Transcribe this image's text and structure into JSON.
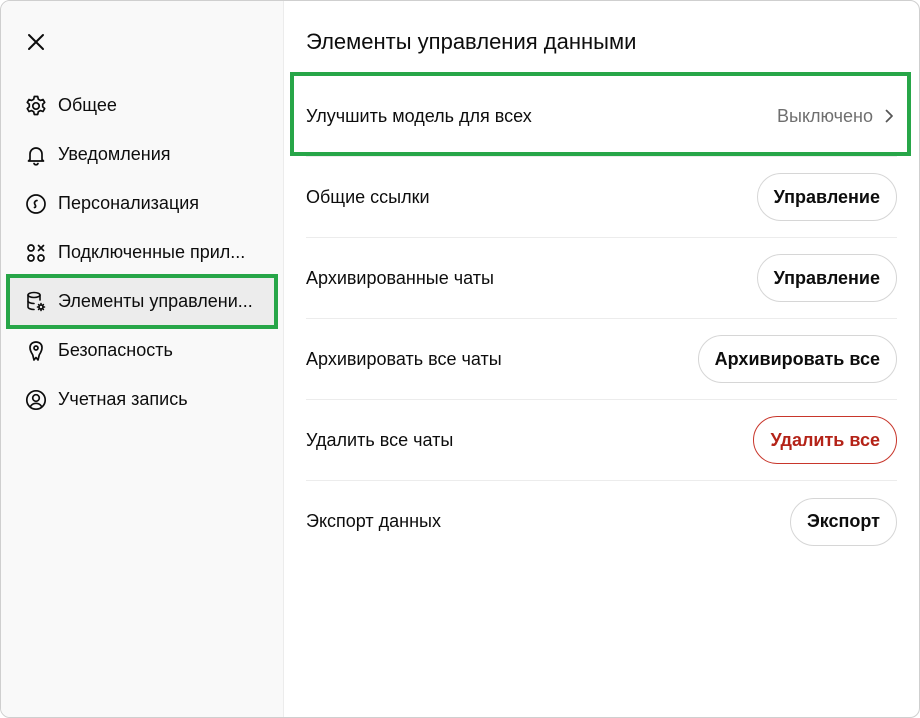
{
  "sidebar": {
    "items": [
      {
        "label": "Общее",
        "icon": "gear-icon"
      },
      {
        "label": "Уведомления",
        "icon": "bell-icon"
      },
      {
        "label": "Персонализация",
        "icon": "personalization-icon"
      },
      {
        "label": "Подключенные прил...",
        "icon": "connected-apps-icon"
      },
      {
        "label": "Элементы управлени...",
        "icon": "database-gear-icon"
      },
      {
        "label": "Безопасность",
        "icon": "shield-icon"
      },
      {
        "label": "Учетная запись",
        "icon": "user-circle-icon"
      }
    ],
    "active_index": 4
  },
  "main": {
    "title": "Элементы управления данными",
    "improve": {
      "label": "Улучшить модель для всех",
      "value": "Выключено"
    },
    "rows": [
      {
        "label": "Общие ссылки",
        "button": "Управление"
      },
      {
        "label": "Архивированные чаты",
        "button": "Управление"
      },
      {
        "label": "Архивировать все чаты",
        "button": "Архивировать все"
      },
      {
        "label": "Удалить все чаты",
        "button": "Удалить все"
      },
      {
        "label": "Экспорт данных",
        "button": "Экспорт"
      }
    ]
  },
  "colors": {
    "highlight": "#27a648",
    "danger": "#b42318",
    "muted": "#6f6f6f"
  }
}
